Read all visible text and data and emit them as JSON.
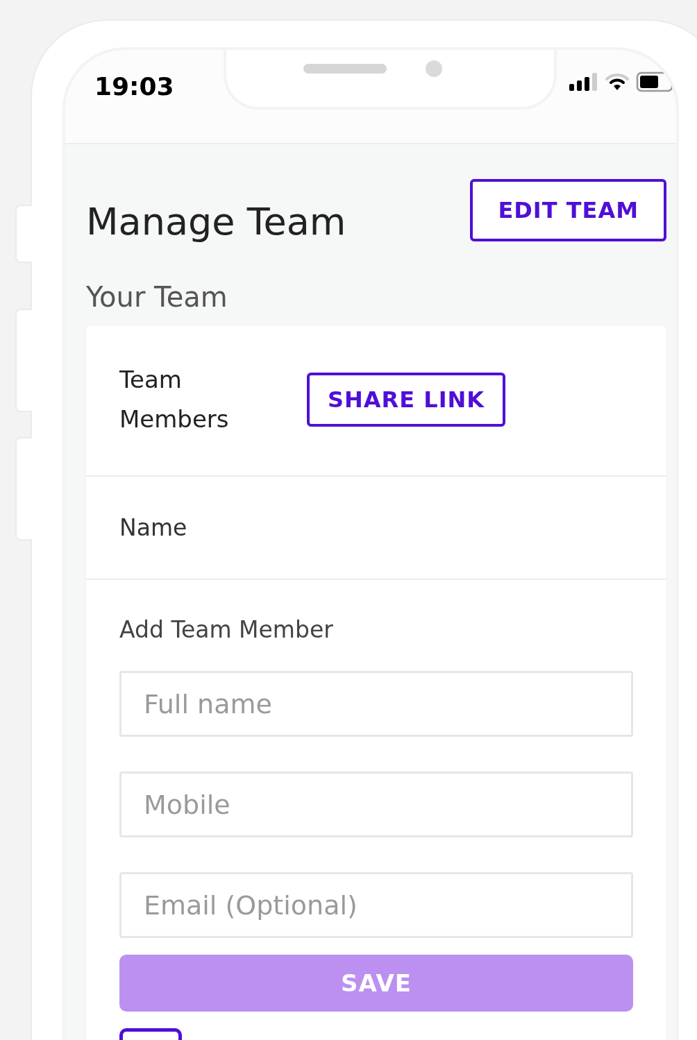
{
  "status_bar": {
    "time": "19:03"
  },
  "header": {
    "title": "Manage Team",
    "action": "EDIT TEAM"
  },
  "section_title": "Your Team",
  "card": {
    "heading": "Team Members",
    "share_button": "SHARE LINK",
    "column_header": "Name",
    "form_title": "Add Team Member",
    "fields": [
      {
        "placeholder": "Full name"
      },
      {
        "placeholder": "Mobile"
      },
      {
        "placeholder": "Email (Optional)"
      }
    ],
    "save_button": {
      "label": "SAVE",
      "disabled": true
    }
  }
}
